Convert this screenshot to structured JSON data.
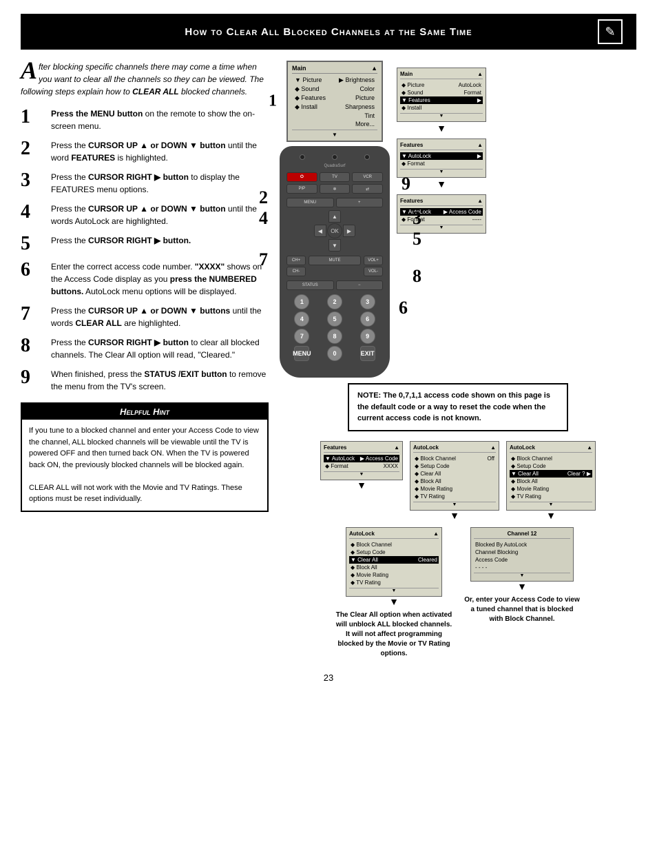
{
  "header": {
    "title": "How to Clear All Blocked Channels at the Same Time",
    "icon": "📋"
  },
  "intro": {
    "drop_cap": "A",
    "text": "fter blocking specific channels there may come a time when you want to clear all the channels so they can be viewed. The following steps explain how to CLEAR ALL blocked channels."
  },
  "steps": [
    {
      "number": "1",
      "html": "<b>Press the MENU button</b> on the remote to show the on-screen menu."
    },
    {
      "number": "2",
      "html": "Press the <b>CURSOR UP ▲ or DOWN ▼ button</b> until the word <b>FEATURES</b> is highlighted."
    },
    {
      "number": "3",
      "html": "Press the <b>CURSOR RIGHT ▶ button</b> to display the FEATURES menu options."
    },
    {
      "number": "4",
      "html": "Press the <b>CURSOR UP ▲ or DOWN ▼ button</b> until the words AutoLock are highlighted."
    },
    {
      "number": "5",
      "html": "Press the <b>CURSOR RIGHT ▶ button.</b>"
    },
    {
      "number": "6",
      "html": "Enter the correct access code number. <b>\"XXXX\"</b> shows on the Access Code display as you <b>press the NUMBERED buttons.</b> AutoLock menu options will be displayed."
    },
    {
      "number": "7",
      "html": "Press the <b>CURSOR UP ▲ or DOWN ▼ buttons</b> until the words <b>CLEAR ALL</b> are highlighted."
    },
    {
      "number": "8",
      "html": "Press the <b>CURSOR RIGHT ▶ button</b> to clear all blocked channels. The Clear All option will read, \"Cleared.\""
    },
    {
      "number": "9",
      "html": "When finished, press the <b>STATUS /EXIT button</b> to remove the menu from the TV's screen."
    }
  ],
  "hint": {
    "title": "Helpful Hint",
    "text1": "If you tune to a blocked channel and enter your Access Code to view the channel, ALL blocked channels will be viewable until the TV is powered OFF and then turned back ON. When the TV is powered back ON, the previously blocked channels will be blocked again.",
    "text2": "CLEAR ALL will not work with the Movie and TV Ratings. These options must be reset individually."
  },
  "note": {
    "text": "NOTE: The 0,7,1,1 access code shown on this page is the default code or a way to reset the code when the current access code is not known."
  },
  "menus": {
    "main_menu": {
      "title": "Main",
      "title_arrow": "▲",
      "items": [
        {
          "label": "▼ Picture",
          "value": "▶ Brightness"
        },
        {
          "label": "◆ Sound",
          "value": "Color"
        },
        {
          "label": "◆ Features",
          "value": "Picture"
        },
        {
          "label": "◆ Install",
          "value": "Sharpness"
        },
        {
          "label": "",
          "value": "Tint"
        },
        {
          "label": "",
          "value": "More..."
        }
      ]
    },
    "features_screen1": {
      "title": "Main",
      "title_arrow": "▲",
      "items": [
        {
          "label": "◆ Picture",
          "value": "AutoLock",
          "selected": false
        },
        {
          "label": "◆ Sound",
          "value": "Format",
          "selected": false
        },
        {
          "label": "▼ Features",
          "value": "▶",
          "selected": true
        },
        {
          "label": "◆ Install",
          "value": "",
          "selected": false
        }
      ]
    },
    "features_screen2": {
      "title": "Features",
      "title_arrow": "▲",
      "items": [
        {
          "label": "▼ AutoLock",
          "value": "▶",
          "selected": true
        },
        {
          "label": "◆ Format",
          "value": "",
          "selected": false
        }
      ]
    },
    "autolock_screen1": {
      "title": "Features",
      "title_arrow": "▲",
      "items": [
        {
          "label": "▼ AutoLock",
          "value": "▶ Access Code",
          "selected": true
        },
        {
          "label": "◆ Format",
          "value": "-----",
          "selected": false
        }
      ]
    },
    "autolock_screen2": {
      "title": "Features",
      "title_arrow": "▲",
      "items": [
        {
          "label": "▼ AutoLock",
          "value": "▶ Access Code",
          "selected": true
        },
        {
          "label": "◆ Format",
          "value": "XXXX",
          "selected": false
        }
      ]
    },
    "autolock_menu": {
      "title": "AutoLock",
      "title_arrow": "▲",
      "items": [
        {
          "label": "◆ Block Channel",
          "value": "Off"
        },
        {
          "label": "◆ Setup Code",
          "value": ""
        },
        {
          "label": "◆ Clear All",
          "value": ""
        },
        {
          "label": "◆ Block All",
          "value": ""
        },
        {
          "label": "◆ Movie Rating",
          "value": ""
        },
        {
          "label": "◆ TV Rating",
          "value": ""
        }
      ]
    },
    "clear_all_screen": {
      "title": "AutoLock",
      "title_arrow": "▲",
      "items": [
        {
          "label": "◆ Block Channel",
          "value": ""
        },
        {
          "label": "◆ Setup Code",
          "value": ""
        },
        {
          "label": "▼ Clear All",
          "value": "Clear ? ▶",
          "selected": true
        },
        {
          "label": "◆ Block All",
          "value": ""
        },
        {
          "label": "◆ Movie Rating",
          "value": ""
        },
        {
          "label": "◆ TV Rating",
          "value": ""
        }
      ]
    },
    "cleared_screen": {
      "title": "AutoLock",
      "title_arrow": "▲",
      "items": [
        {
          "label": "◆ Block Channel",
          "value": ""
        },
        {
          "label": "◆ Setup Code",
          "value": ""
        },
        {
          "label": "▼ Clear All",
          "value": "Cleared",
          "selected": true
        },
        {
          "label": "◆ Block All",
          "value": ""
        },
        {
          "label": "◆ Movie Rating",
          "value": ""
        },
        {
          "label": "◆ TV Rating",
          "value": ""
        }
      ]
    },
    "channel_blocked": {
      "title": "Channel 12",
      "items": [
        {
          "label": "Blocked By AutoLock"
        },
        {
          "label": "Channel Blocking"
        },
        {
          "label": "Access Code"
        },
        {
          "label": "----"
        }
      ]
    }
  },
  "bottom_captions": {
    "left": "The Clear All option when activated will unblock ALL blocked channels. It will not affect programming blocked by the Movie or TV Rating options.",
    "right": "Or, enter your Access Code to view a tuned channel that is blocked with Block Channel."
  },
  "page_number": "23",
  "labels": {
    "num_pad": [
      "1",
      "2",
      "3",
      "4",
      "5",
      "6",
      "7",
      "8",
      "9",
      "MENU",
      "0",
      "EXIT"
    ]
  }
}
